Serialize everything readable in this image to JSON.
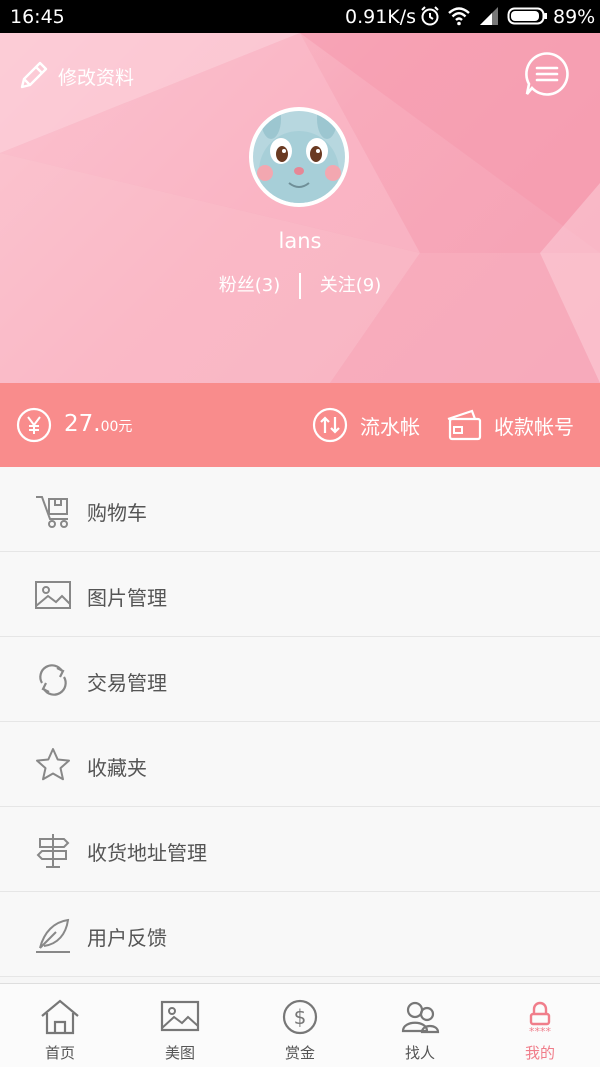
{
  "status_bar": {
    "time": "16:45",
    "network_speed": "0.91K/s",
    "battery": "89%"
  },
  "header": {
    "edit_profile_label": "修改资料",
    "username": "lans",
    "fans_label": "粉丝(3)",
    "following_label": "关注(9)"
  },
  "balance": {
    "amount_integer": "27.",
    "amount_decimal": "00元",
    "flow_label": "流水帐",
    "account_label": "收款帐号"
  },
  "menu": {
    "items": [
      {
        "label": "购物车",
        "icon": "cart-icon"
      },
      {
        "label": "图片管理",
        "icon": "image-icon"
      },
      {
        "label": "交易管理",
        "icon": "refresh-icon"
      },
      {
        "label": "收藏夹",
        "icon": "star-icon"
      },
      {
        "label": "收货地址管理",
        "icon": "signpost-icon"
      },
      {
        "label": "用户反馈",
        "icon": "feather-icon"
      }
    ]
  },
  "tabbar": {
    "tabs": [
      {
        "label": "首页",
        "icon": "home-icon"
      },
      {
        "label": "美图",
        "icon": "picture-icon"
      },
      {
        "label": "赏金",
        "icon": "dollar-icon"
      },
      {
        "label": "找人",
        "icon": "people-icon"
      },
      {
        "label": "我的",
        "icon": "lock-icon",
        "active": true
      }
    ]
  },
  "colors": {
    "header_pink": "#f8aabb",
    "balance_bar": "#f98c8c",
    "active_tab": "#f07d8a",
    "icon_gray": "#888888"
  }
}
